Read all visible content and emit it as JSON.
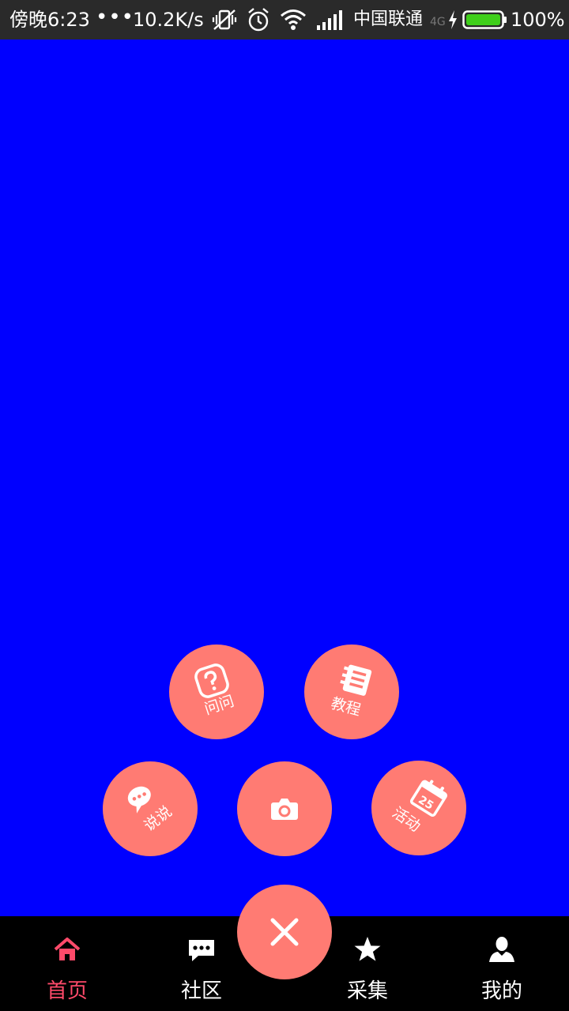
{
  "status_bar": {
    "time": "傍晚6:23",
    "dots": "•••",
    "speed": "10.2K/s",
    "carrier": "中国联通",
    "network": "4G",
    "battery": "100%",
    "icons": [
      "vibrate-off-icon",
      "alarm-icon",
      "wifi-icon",
      "signal-icon",
      "charging-icon",
      "battery-icon"
    ]
  },
  "radial_menu": {
    "ask": {
      "label": "问问",
      "icon": "question-icon"
    },
    "tutorial": {
      "label": "教程",
      "icon": "notebook-icon"
    },
    "talk": {
      "label": "说说",
      "icon": "chat-bubble-icon"
    },
    "camera": {
      "icon": "camera-icon"
    },
    "activity": {
      "label": "活动",
      "icon": "calendar-icon",
      "calendar_day": "25"
    },
    "close": {
      "icon": "close-icon"
    }
  },
  "bottom_nav": {
    "items": [
      {
        "label": "首页",
        "icon": "home-icon",
        "active": true
      },
      {
        "label": "社区",
        "icon": "chat-icon",
        "active": false
      },
      {
        "label": "采集",
        "icon": "star-icon",
        "active": false
      },
      {
        "label": "我的",
        "icon": "user-icon",
        "active": false
      }
    ]
  },
  "colors": {
    "background": "#0000ff",
    "fab": "#ff7b73",
    "nav_bg": "#000000",
    "nav_active": "#ff4a6a",
    "battery_fill": "#3fcf1a"
  }
}
